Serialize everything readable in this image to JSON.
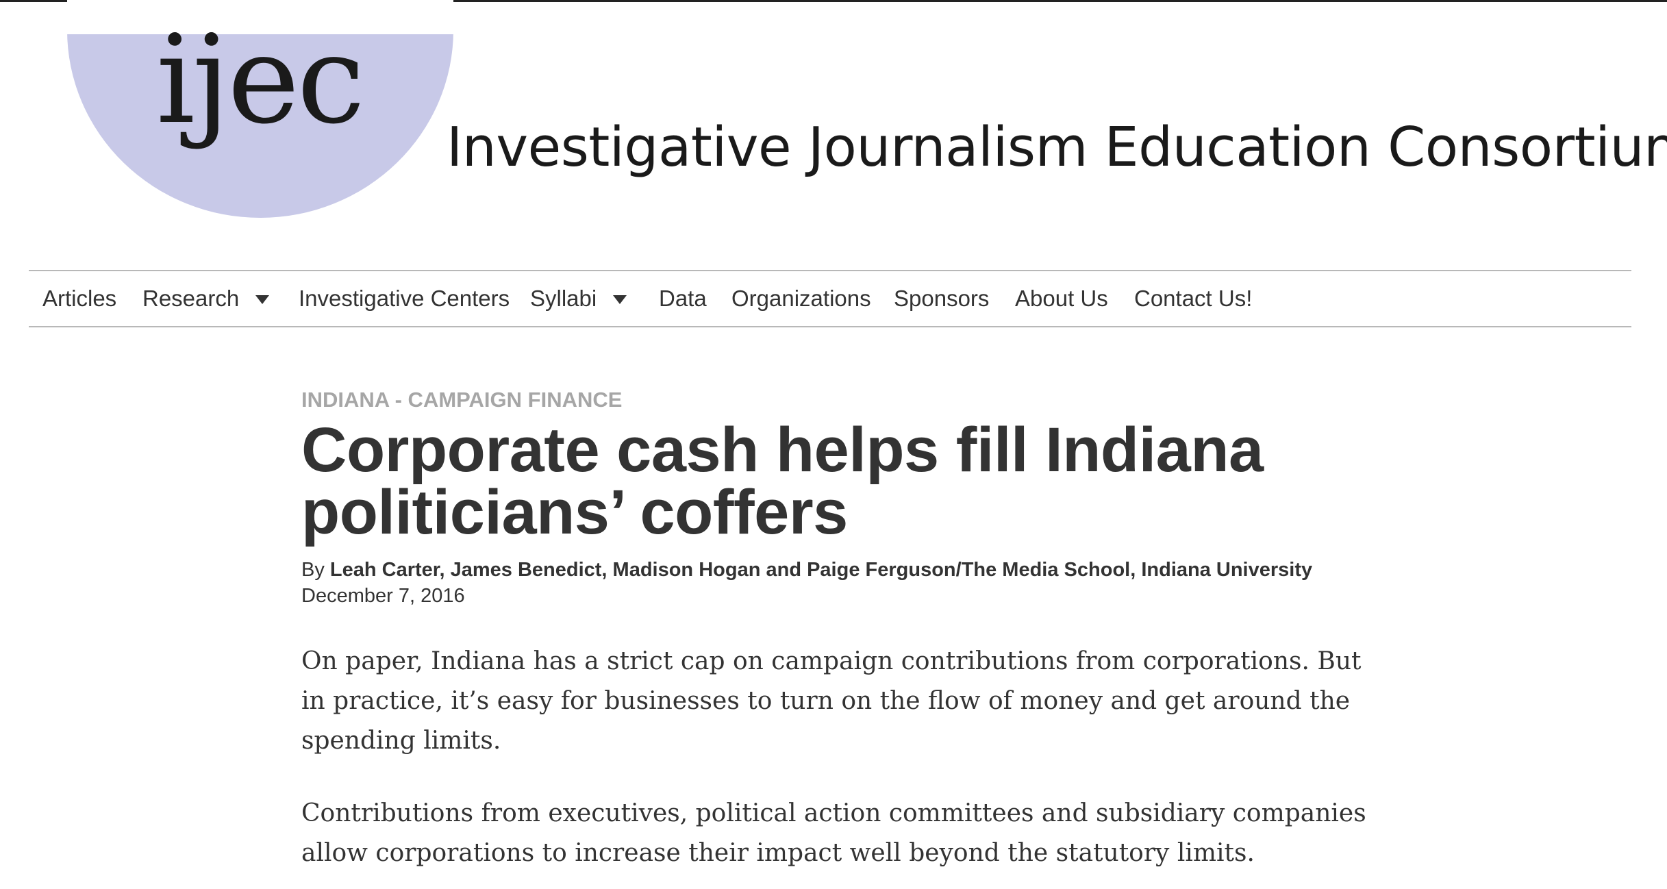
{
  "header": {
    "logo_text": "ijec",
    "site_title": "Investigative Journalism Education Consortium",
    "logo_color": "#c8c9e8"
  },
  "nav": {
    "items": [
      {
        "label": "Articles",
        "dropdown": false
      },
      {
        "label": "Research",
        "dropdown": true
      },
      {
        "label": "Investigative Centers",
        "dropdown": false
      },
      {
        "label": "Syllabi",
        "dropdown": true
      },
      {
        "label": "Data",
        "dropdown": false
      },
      {
        "label": "Organizations",
        "dropdown": false
      },
      {
        "label": "Sponsors",
        "dropdown": false
      },
      {
        "label": "About Us",
        "dropdown": false
      },
      {
        "label": "Contact Us!",
        "dropdown": false
      }
    ]
  },
  "article": {
    "category": "INDIANA - CAMPAIGN FINANCE",
    "headline": "Corporate cash helps fill Indiana politicians’ coffers",
    "byline_prefix": "By ",
    "authors": "Leah Carter, James Benedict, Madison Hogan and Paige Ferguson/The Media School, Indiana University",
    "date": "December 7, 2016",
    "paragraphs": [
      "On paper, Indiana has a strict cap on campaign contributions from corporations. But in practice, it’s easy for businesses to turn on the flow of money and get around the spending limits.",
      "Contributions from executives, political action committees and subsidiary companies allow corporations to increase their impact well beyond the statutory limits."
    ]
  }
}
